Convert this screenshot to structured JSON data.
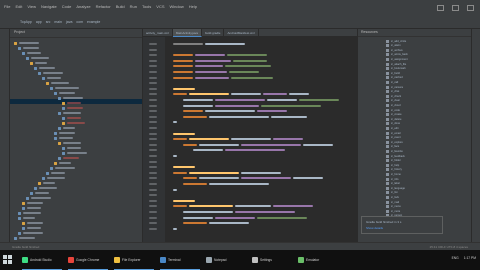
{
  "menu": [
    "File",
    "Edit",
    "View",
    "Navigate",
    "Code",
    "Analyze",
    "Refactor",
    "Build",
    "Run",
    "Tools",
    "VCS",
    "Window",
    "Help"
  ],
  "breadcrumbs": [
    "TopApp",
    "app",
    "src",
    "main",
    "java",
    "com",
    "example"
  ],
  "project_title": "Project",
  "resources_title": "Resources",
  "editor_tabs": [
    "activity_main.xml",
    "MainActivity.java",
    "build.gradle",
    "AndroidManifest.xml"
  ],
  "resource_items": [
    "ic_add_circle",
    "ic_alarm",
    "ic_archive",
    "ic_arrow_back",
    "ic_assignment",
    "ic_attach_file",
    "ic_bookmark",
    "ic_build",
    "ic_cached",
    "ic_call",
    "ic_camera",
    "ic_chat",
    "ic_check",
    "ic_clear",
    "ic_cloud",
    "ic_code",
    "ic_create",
    "ic_delete",
    "ic_done",
    "ic_edit",
    "ic_email",
    "ic_event",
    "ic_explore",
    "ic_face",
    "ic_favorite",
    "ic_feedback",
    "ic_folder",
    "ic_help",
    "ic_history",
    "ic_home",
    "ic_info",
    "ic_label",
    "ic_language",
    "ic_list",
    "ic_lock",
    "ic_mail",
    "ic_menu",
    "ic_more",
    "ic_person",
    "ic_phone",
    "ic_place",
    "ic_search"
  ],
  "popup": {
    "line1": "Gradle build finished in 3 s",
    "line2": "Show details"
  },
  "status": {
    "left": "Gradle build finished",
    "right": "25:41  CRLF  UTF-8  4 spaces"
  },
  "taskbar": [
    {
      "label": "Android Studio",
      "color": "#3ddc84"
    },
    {
      "label": "Google Chrome",
      "color": "#e8453c"
    },
    {
      "label": "File Explorer",
      "color": "#f0c040"
    },
    {
      "label": "Terminal",
      "color": "#4a88c7"
    },
    {
      "label": "Notepad",
      "color": "#9aa7b0"
    },
    {
      "label": "Settings",
      "color": "#c0c0c0"
    },
    {
      "label": "Emulator",
      "color": "#6abf69"
    }
  ],
  "tray": [
    "ENG",
    "1:17 PM"
  ]
}
